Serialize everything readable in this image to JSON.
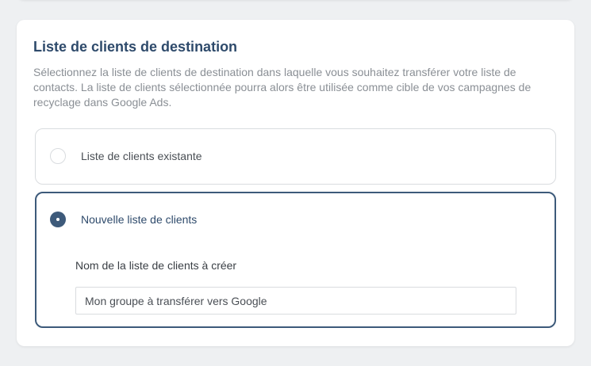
{
  "section": {
    "title": "Liste de clients de destination",
    "description": "Sélectionnez la liste de clients de destination dans laquelle vous souhaitez transférer votre liste de contacts. La liste de clients sélectionnée pourra alors être utilisée comme cible de vos campagnes de recyclage dans Google Ads."
  },
  "options": {
    "existing": {
      "label": "Liste de clients existante",
      "selected": false
    },
    "new": {
      "label": "Nouvelle liste de clients",
      "selected": true,
      "field_label": "Nom de la liste de clients à créer",
      "field_value": "Mon groupe à transférer vers Google"
    }
  },
  "colors": {
    "accent": "#3d5a7a",
    "title": "#2e4a6b",
    "border": "#d9dcdf",
    "background": "#eef0f2"
  }
}
